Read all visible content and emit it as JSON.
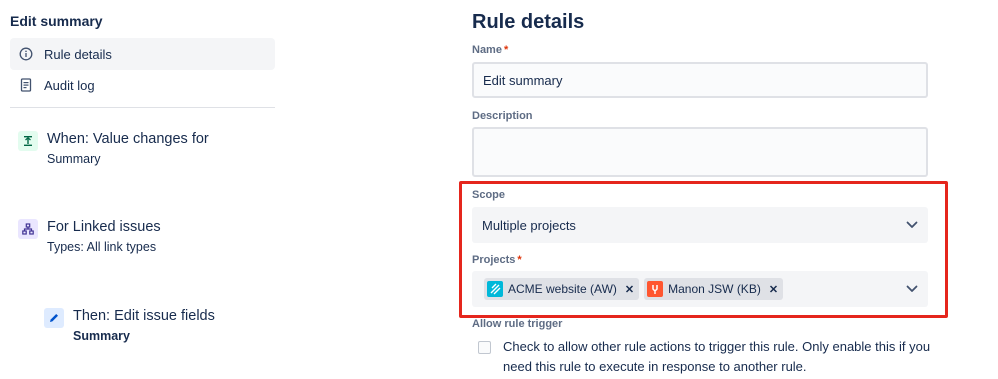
{
  "sidebar": {
    "title": "Edit summary",
    "nav": [
      {
        "label": "Rule details",
        "icon": "info-icon",
        "active": true
      },
      {
        "label": "Audit log",
        "icon": "document-icon",
        "active": false
      }
    ],
    "steps": [
      {
        "title": "When: Value changes for",
        "subtitle": "Summary",
        "icon": "trigger-icon",
        "color": "#e3fcef"
      },
      {
        "title": "For Linked issues",
        "subtitle": "Types: All link types",
        "icon": "branch-icon",
        "color": "#eae6ff"
      },
      {
        "title": "Then: Edit issue fields",
        "subtitle": "Summary",
        "icon": "pencil-icon",
        "color": "#deebff"
      }
    ]
  },
  "form": {
    "title": "Rule details",
    "name_label": "Name",
    "name_value": "Edit summary",
    "description_label": "Description",
    "description_value": "",
    "scope_label": "Scope",
    "scope_value": "Multiple projects",
    "projects_label": "Projects",
    "projects": [
      {
        "label": "ACME website (AW)",
        "color": "#00b8d9"
      },
      {
        "label": "Manon JSW (KB)",
        "color": "#ff5630"
      }
    ],
    "allow_trigger_label": "Allow rule trigger",
    "allow_trigger_text": "Check to allow other rule actions to trigger this rule. Only enable this if you need this rule to execute in response to another rule.",
    "required_mark": "*"
  },
  "colors": {
    "highlight": "#e5261d",
    "text": "#172b4d",
    "muted": "#5e6c84"
  }
}
